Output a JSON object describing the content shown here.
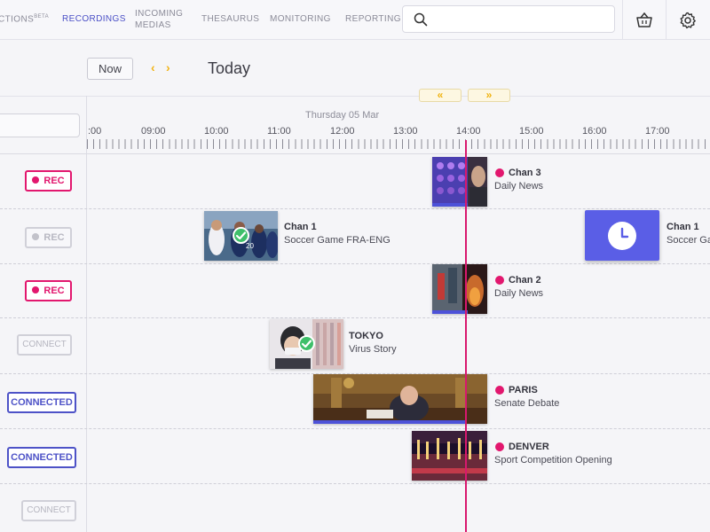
{
  "nav": {
    "items": [
      {
        "label": "CTIONS",
        "sup": "BETA"
      },
      {
        "label": "RECORDINGS"
      },
      {
        "label_line1": "INCOMING",
        "label_line2": "MEDIAS"
      },
      {
        "label": "THESAURUS"
      },
      {
        "label": "MONITORING"
      },
      {
        "label": "REPORTING"
      }
    ],
    "active": "RECORDINGS",
    "search_placeholder": "",
    "icons": [
      "search-icon",
      "basket-icon",
      "gear-icon"
    ]
  },
  "controls": {
    "now_label": "Now",
    "prev_icon": "‹",
    "next_icon": "›",
    "title": "Today",
    "rewind_icon": "«",
    "forward_icon": "»"
  },
  "timeline": {
    "date": "Thursday 05 Mar",
    "hours": [
      ":00",
      "09:00",
      "10:00",
      "11:00",
      "12:00",
      "13:00",
      "14:00",
      "15:00",
      "16:00",
      "17:00"
    ],
    "current_time": "13:58"
  },
  "channels": [
    {
      "status": "REC",
      "state": "recording"
    },
    {
      "status": "REC",
      "state": "idle"
    },
    {
      "status": "REC",
      "state": "recording"
    },
    {
      "status": "CONNECT",
      "state": "disconnected"
    },
    {
      "status": "CONNECTED",
      "state": "connected"
    },
    {
      "status": "CONNECTED",
      "state": "connected"
    },
    {
      "status": "CONNECT",
      "state": "disconnected"
    }
  ],
  "recordings": [
    {
      "title": "Chan 3",
      "subtitle": "Daily News",
      "live": true
    },
    {
      "title": "Chan 1",
      "subtitle": "Soccer Game FRA-ENG",
      "live": false,
      "checked": true
    },
    {
      "title": "Chan 1",
      "subtitle": "Soccer Gam",
      "scheduled": true,
      "icon": "clock-icon"
    },
    {
      "title": "Chan 2",
      "subtitle": "Daily News",
      "live": true
    },
    {
      "title": "TOKYO",
      "subtitle": "Virus Story",
      "live": false,
      "checked": true
    },
    {
      "title": "PARIS",
      "subtitle": "Senate Debate",
      "live": true
    },
    {
      "title": "DENVER",
      "subtitle": "Sport Competition Opening",
      "live": true
    }
  ],
  "colors": {
    "accent": "#4d52c7",
    "rec": "#e2176e",
    "now_line": "#d8186e",
    "arrows": "#f2b417"
  }
}
